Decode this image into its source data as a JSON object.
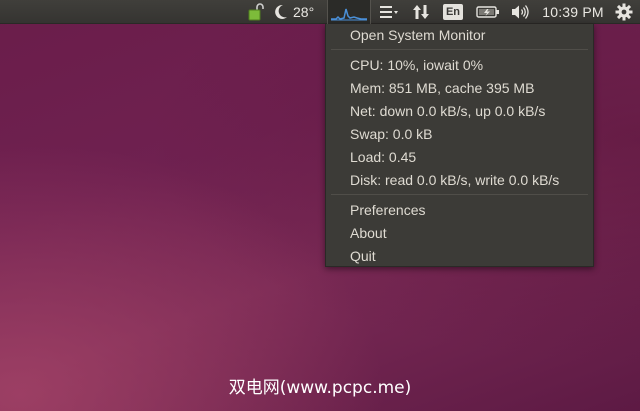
{
  "panel": {
    "temperature": "28°",
    "language": "En",
    "clock": "10:39 PM",
    "icons": [
      "lock-update-icon",
      "weather-moon-icon",
      "system-monitor-graph-icon",
      "messaging-menu-icon",
      "network-transfer-icon",
      "battery-icon",
      "volume-icon",
      "gear-icon"
    ],
    "graph_color": "#4a90d9"
  },
  "menu": {
    "open_monitor": "Open System Monitor",
    "cpu": "CPU: 10%, iowait 0%",
    "mem": "Mem: 851 MB, cache 395 MB",
    "net": "Net: down 0.0 kB/s, up 0.0 kB/s",
    "swap": "Swap: 0.0 kB",
    "load": "Load: 0.45",
    "disk": "Disk: read 0.0 kB/s, write 0.0 kB/s",
    "preferences": "Preferences",
    "about": "About",
    "quit": "Quit"
  },
  "watermark": "双电网(www.pcpc.me)",
  "colors": {
    "panel_bg": "#3c3b37",
    "menu_bg": "#3c3b37",
    "menu_text": "#dfdbd2",
    "desktop_bg": "#6f2150"
  }
}
